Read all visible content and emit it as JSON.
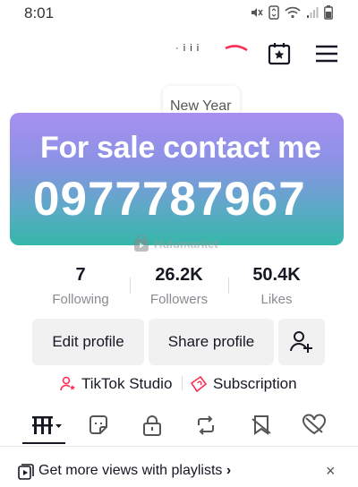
{
  "status_bar": {
    "time": "8:01",
    "icons": [
      "mute-icon",
      "cellular-data-icon",
      "wifi-icon",
      "signal-icon",
      "battery-icon"
    ]
  },
  "top_nav": {
    "partial_name": "· i i i",
    "icons": [
      "calendar-star-icon",
      "hamburger-menu-icon"
    ]
  },
  "bubble": {
    "text": "New Year"
  },
  "banner": {
    "line1": "For sale contact me",
    "line2": "0977787967",
    "gradient": [
      "#a78ff0",
      "#35b7aa"
    ]
  },
  "watermark": {
    "text": "Hulumarket"
  },
  "stats": [
    {
      "value": "7",
      "label": "Following"
    },
    {
      "value": "26.2K",
      "label": "Followers"
    },
    {
      "value": "50.4K",
      "label": "Likes"
    }
  ],
  "actions": {
    "edit_profile": "Edit profile",
    "share_profile": "Share profile",
    "add_friend_icon": "add-person-icon"
  },
  "links": {
    "studio": "TikTok Studio",
    "subscription": "Subscription",
    "accent": "#fe2c55"
  },
  "tabs": [
    {
      "icon": "videos-grid-icon"
    },
    {
      "icon": "sticker-icon"
    },
    {
      "icon": "lock-icon"
    },
    {
      "icon": "repost-icon"
    },
    {
      "icon": "saved-icon"
    },
    {
      "icon": "liked-heart-icon"
    }
  ],
  "playlist_bar": {
    "text": "Get more views with playlists",
    "chevron": "›",
    "close": "×"
  }
}
